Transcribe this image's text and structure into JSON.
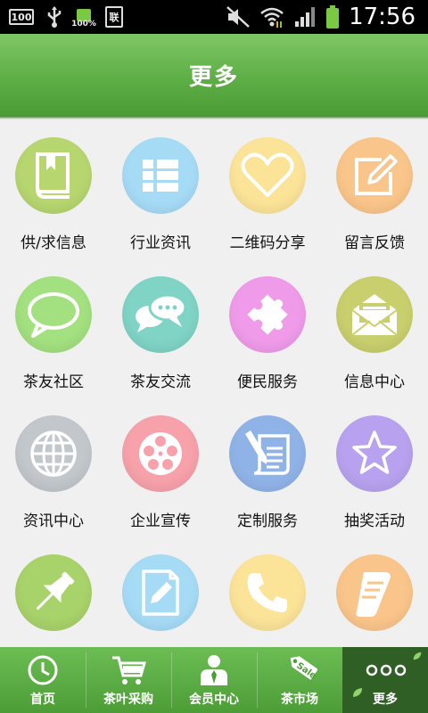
{
  "status_bar": {
    "time": "17:56",
    "left_box": "100",
    "battery_small_text": "100%",
    "sim_text": "联"
  },
  "header": {
    "title": "更多"
  },
  "grid": {
    "items": [
      {
        "label": "供/求信息",
        "icon": "book-icon",
        "color": "#b7d66f"
      },
      {
        "label": "行业资讯",
        "icon": "list-icon",
        "color": "#a6dbf6"
      },
      {
        "label": "二维码分享",
        "icon": "heart-icon",
        "color": "#fbe398"
      },
      {
        "label": "留言反馈",
        "icon": "edit-icon",
        "color": "#f9c58a"
      },
      {
        "label": "茶友社区",
        "icon": "chat-bubble-icon",
        "color": "#a3e07f"
      },
      {
        "label": "茶友交流",
        "icon": "chat-bubbles-icon",
        "color": "#7fd4c5"
      },
      {
        "label": "便民服务",
        "icon": "puzzle-icon",
        "color": "#ef9be9"
      },
      {
        "label": "信息中心",
        "icon": "envelope-icon",
        "color": "#c9cf6c"
      },
      {
        "label": "资讯中心",
        "icon": "globe-icon",
        "color": "#c2c7cc"
      },
      {
        "label": "企业宣传",
        "icon": "film-reel-icon",
        "color": "#f7a1ab"
      },
      {
        "label": "定制服务",
        "icon": "document-pen-icon",
        "color": "#90b3e7"
      },
      {
        "label": "抽奖活动",
        "icon": "star-icon",
        "color": "#b8a2ef"
      },
      {
        "label": "",
        "icon": "pushpin-icon",
        "color": "#a8d26a"
      },
      {
        "label": "",
        "icon": "note-pencil-icon",
        "color": "#a6dbf6"
      },
      {
        "label": "",
        "icon": "phone-icon",
        "color": "#fbe398"
      },
      {
        "label": "",
        "icon": "scroll-icon",
        "color": "#f9c58a"
      }
    ]
  },
  "bottom_nav": {
    "items": [
      {
        "label": "首页",
        "icon": "clock-icon"
      },
      {
        "label": "茶叶采购",
        "icon": "cart-icon"
      },
      {
        "label": "会员中心",
        "icon": "member-icon"
      },
      {
        "label": "茶市场",
        "icon": "sale-tag-icon",
        "tag": "Sale"
      },
      {
        "label": "更多",
        "icon": "more-dots-icon"
      }
    ]
  }
}
